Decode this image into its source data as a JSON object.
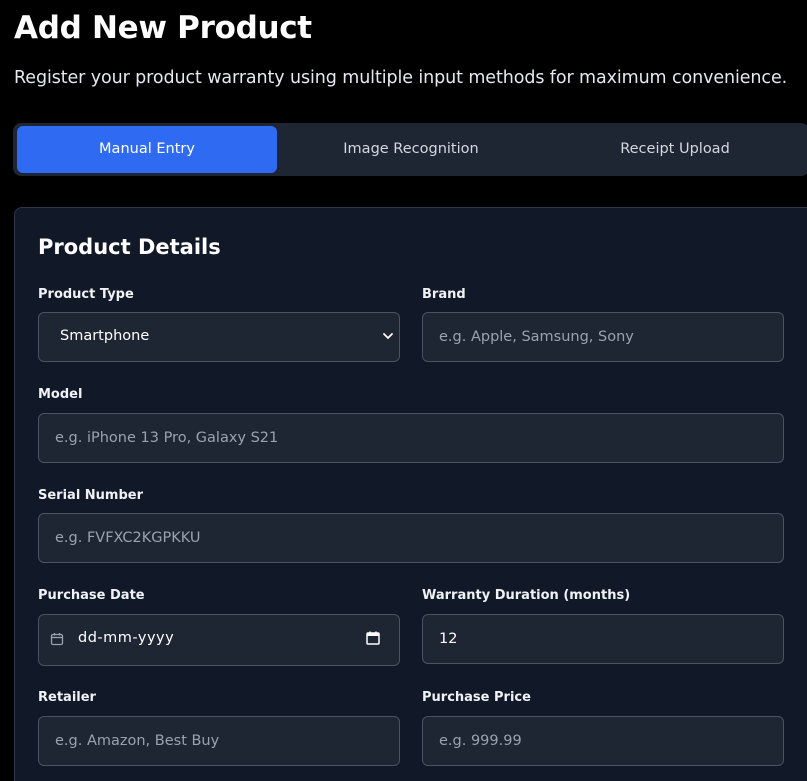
{
  "header": {
    "title": "Add New Product",
    "subtitle": "Register your product warranty using multiple input methods for maximum convenience."
  },
  "tabs": [
    {
      "label": "Manual Entry",
      "active": true
    },
    {
      "label": "Image Recognition",
      "active": false
    },
    {
      "label": "Receipt Upload",
      "active": false
    }
  ],
  "form": {
    "title": "Product Details",
    "product_type": {
      "label": "Product Type",
      "value": "Smartphone"
    },
    "brand": {
      "label": "Brand",
      "placeholder": "e.g. Apple, Samsung, Sony"
    },
    "model": {
      "label": "Model",
      "placeholder": "e.g. iPhone 13 Pro, Galaxy S21"
    },
    "serial_number": {
      "label": "Serial Number",
      "placeholder": "e.g. FVFXC2KGPKKU"
    },
    "purchase_date": {
      "label": "Purchase Date",
      "placeholder": "dd-mm-yyyy",
      "icon": "calendar-icon"
    },
    "warranty_duration": {
      "label": "Warranty Duration (months)",
      "value": "12"
    },
    "retailer": {
      "label": "Retailer",
      "placeholder": "e.g. Amazon, Best Buy"
    },
    "purchase_price": {
      "label": "Purchase Price",
      "placeholder": "e.g. 999.99"
    }
  },
  "colors": {
    "background": "#000000",
    "card": "#111827",
    "input": "#1e2533",
    "accent": "#2f6bf2"
  }
}
